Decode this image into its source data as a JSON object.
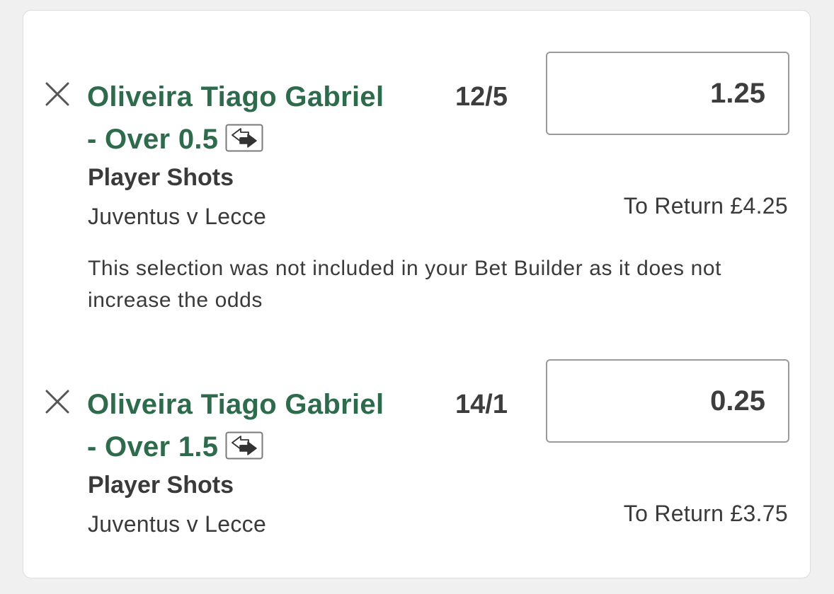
{
  "bets": [
    {
      "selection_line1": "Oliveira Tiago Gabriel",
      "selection_line2": "- Over 0.5",
      "odds": "12/5",
      "stake": "1.25",
      "market": "Player Shots",
      "event": "Juventus v Lecce",
      "to_return": "To Return £4.25",
      "notice": "This selection was not included in your Bet Builder as it does not increase the odds"
    },
    {
      "selection_line1": "Oliveira Tiago Gabriel",
      "selection_line2": "- Over 1.5",
      "odds": "14/1",
      "stake": "0.25",
      "market": "Player Shots",
      "event": "Juventus v Lecce",
      "to_return": "To Return £3.75"
    }
  ],
  "icons": {
    "remove": "close-icon",
    "swap": "swap-arrows-icon"
  },
  "colors": {
    "selection_green": "#2e6b4d",
    "text_dark": "#3a3a3a",
    "input_border": "#9a9a9a",
    "background": "#f0f0f0"
  }
}
